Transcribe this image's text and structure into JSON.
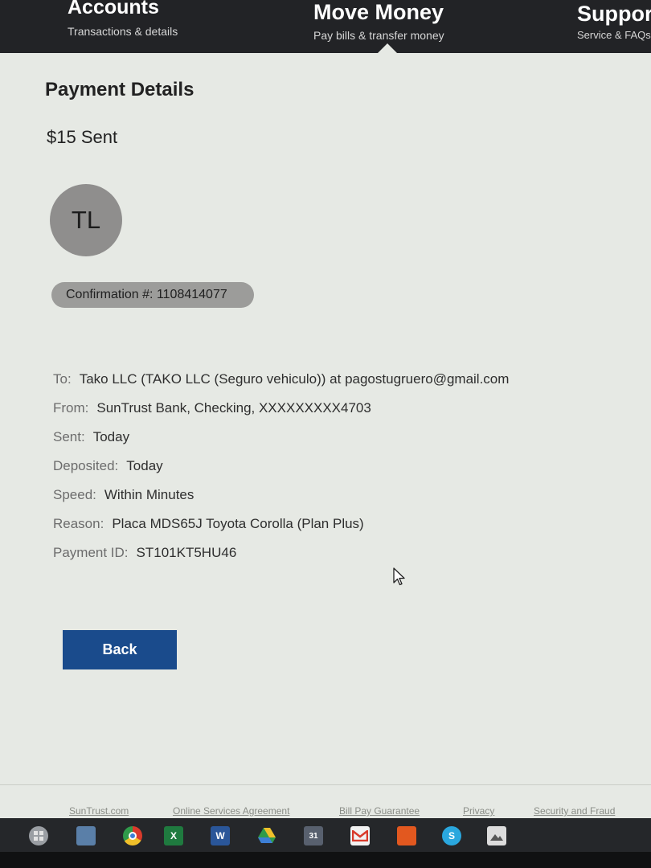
{
  "nav": {
    "accounts": {
      "title": "Accounts",
      "sub": "Transactions & details"
    },
    "move": {
      "title": "Move Money",
      "sub": "Pay bills & transfer money"
    },
    "support": {
      "title": "Suppor",
      "sub": "Service & FAQs"
    }
  },
  "page": {
    "title": "Payment Details",
    "amount": "$15 Sent",
    "avatar_initials": "TL",
    "confirmation": "Confirmation #: 1108414077"
  },
  "details": {
    "to": {
      "label": "To:",
      "value": "Tako LLC (TAKO LLC (Seguro vehiculo)) at pagostugruero@gmail.com"
    },
    "from": {
      "label": "From:",
      "value": "SunTrust Bank, Checking, XXXXXXXXX4703"
    },
    "sent": {
      "label": "Sent:",
      "value": "Today"
    },
    "deposited": {
      "label": "Deposited:",
      "value": "Today"
    },
    "speed": {
      "label": "Speed:",
      "value": "Within Minutes"
    },
    "reason": {
      "label": "Reason:",
      "value": "Placa MDS65J Toyota Corolla (Plan Plus)"
    },
    "payment_id": {
      "label": "Payment ID:",
      "value": "ST101KT5HU46"
    }
  },
  "buttons": {
    "back": "Back"
  },
  "footer": {
    "links": [
      "SunTrust.com",
      "Online Services Agreement",
      "Bill Pay Guarantee",
      "Privacy",
      "Security and Fraud"
    ]
  },
  "taskbar": {
    "icons": [
      "start-icon",
      "file-explorer-icon",
      "chrome-icon",
      "excel-icon",
      "word-icon",
      "google-drive-icon",
      "calendar-icon",
      "gmail-icon",
      "office-icon",
      "skype-icon",
      "photos-icon"
    ],
    "calendar_day": "31",
    "excel_letter": "X",
    "word_letter": "W",
    "skype_letter": "S"
  },
  "colors": {
    "nav_bg": "#222326",
    "page_bg": "#e6e9e4",
    "button_bg": "#1a4b8c",
    "avatar_bg": "#8f8e8d",
    "confirmation_bg": "#9c9c9a"
  }
}
